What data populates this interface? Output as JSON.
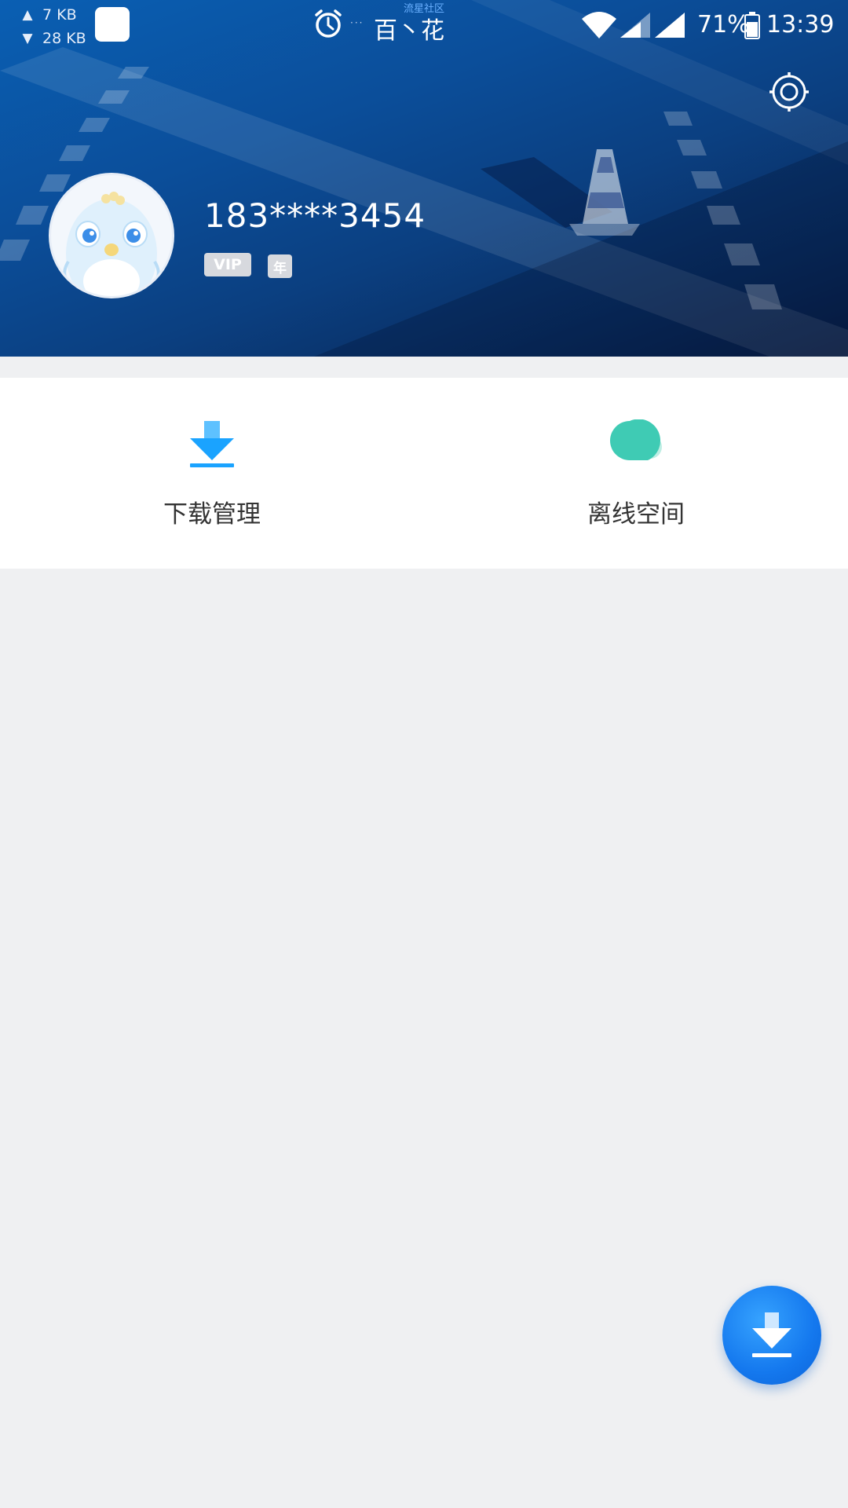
{
  "status_bar": {
    "upload_speed": "7 KB",
    "download_speed": "28 KB",
    "carrier": "百丶花",
    "watermark": "流星社区",
    "battery": "71%",
    "time": "13:39"
  },
  "profile": {
    "username": "183****3454",
    "vip_badge": "VIP",
    "year_badge": "年"
  },
  "features": [
    {
      "label": "下载管理",
      "icon": "download-icon"
    },
    {
      "label": "离线空间",
      "icon": "cloud-icon"
    }
  ],
  "colors": {
    "header_blue": "#0b4e9a",
    "accent_blue": "#1478ee",
    "download_icon": "#1aa3ff",
    "cloud_icon": "#3fcbb4",
    "background": "#eff0f2"
  }
}
